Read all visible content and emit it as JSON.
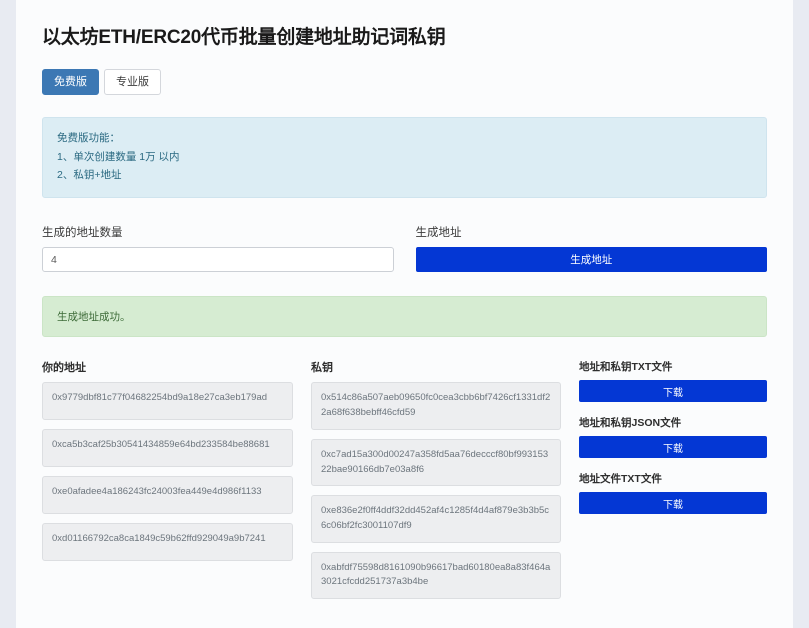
{
  "header": {
    "title": "以太坊ETH/ERC20代币批量创建地址助记词私钥"
  },
  "tabs": [
    {
      "label": "免费版",
      "active": true
    },
    {
      "label": "专业版",
      "active": false
    }
  ],
  "info_box": {
    "lines": [
      "免费版功能：",
      "1、单次创建数量 1万 以内",
      "2、私钥+地址"
    ]
  },
  "form": {
    "count_label": "生成的地址数量",
    "count_value": "4",
    "count_placeholder": "",
    "generate_label": "生成地址",
    "generate_button": "生成地址"
  },
  "alert": {
    "message": "生成地址成功。"
  },
  "results": {
    "address_header": "你的地址",
    "privatekey_header": "私钥",
    "rows": [
      {
        "address": "0x9779dbf81c77f04682254bd9a18e27ca3eb179ad",
        "privatekey": "0x514c86a507aeb09650fc0cea3cbb6bf7426cf1331df22a68f638bebff46cfd59"
      },
      {
        "address": "0xca5b3caf25b30541434859e64bd233584be88681",
        "privatekey": "0xc7ad15a300d00247a358fd5aa76decccf80bf99315322bae90166db7e03a8f6"
      },
      {
        "address": "0xe0afadee4a186243fc24003fea449e4d986f1133",
        "privatekey": "0xe836e2f0ff4ddf32dd452af4c1285f4d4af879e3b3b5c6c06bf2fc3001107df9"
      },
      {
        "address": "0xd01166792ca8ca1849c59b62ffd929049a9b7241",
        "privatekey": "0xabfdf75598d8161090b96617bad60180ea8a83f464a3021cfcdd251737a3b4be"
      }
    ]
  },
  "downloads": [
    {
      "label": "地址和私钥TXT文件",
      "button": "下载"
    },
    {
      "label": "地址和私钥JSON文件",
      "button": "下载"
    },
    {
      "label": "地址文件TXT文件",
      "button": "下载"
    }
  ],
  "colors": {
    "accent_blue": "#0437d4",
    "tab_blue": "#3c78b4",
    "info_bg": "#dcedf4",
    "success_bg": "#d6ecd2",
    "page_bg": "#e8ebf2"
  }
}
